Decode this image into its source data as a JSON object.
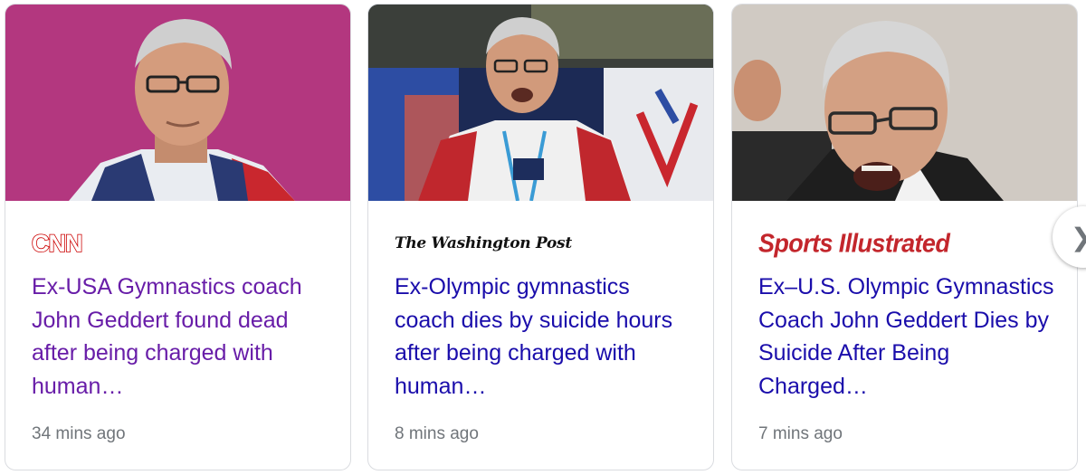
{
  "cards": [
    {
      "source": "CNN",
      "headline": "Ex-USA Gymnastics coach John Geddert found dead after being charged with human…",
      "time": "34 mins ago",
      "visited": true,
      "image_alt": "photo of coach in red-white-blue jacket on magenta background"
    },
    {
      "source": "The Washington Post",
      "headline": "Ex-Olympic gymnastics coach dies by suicide hours after being charged with human…",
      "time": "8 mins ago",
      "visited": false,
      "image_alt": "photo of coach with lanyard in arena"
    },
    {
      "source": "Sports Illustrated",
      "headline": "Ex–U.S. Olympic Gymnastics Coach John Geddert Dies by Suicide After Being Charged…",
      "time": "7 mins ago",
      "visited": false,
      "image_alt": "photo of coach shouting with raised fist"
    }
  ],
  "next_icon": "chevron-right-icon",
  "colors": {
    "visited_link": "#681da8",
    "link": "#1a0dab",
    "meta": "#70757a",
    "cnn_red": "#cc0000",
    "si_red": "#c3262c"
  }
}
